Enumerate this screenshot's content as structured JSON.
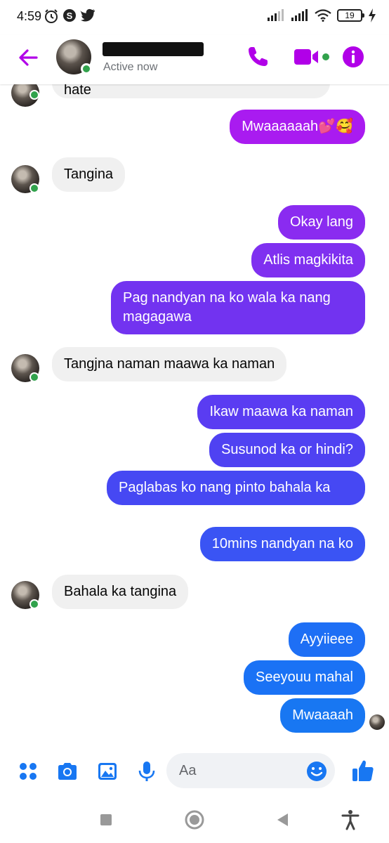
{
  "status_bar": {
    "time": "4:59",
    "battery": "19",
    "icons": [
      "alarm-icon",
      "skype-icon",
      "twitter-icon",
      "signal-icon",
      "signal-icon",
      "wifi-icon",
      "battery-icon",
      "charging-icon"
    ]
  },
  "header": {
    "contact_name": "",
    "status": "Active now",
    "accent_color": "#b100e8",
    "icons": [
      "back-arrow-icon",
      "phone-icon",
      "video-camera-icon",
      "info-icon"
    ]
  },
  "messages": [
    {
      "sender": "them",
      "text": "hate",
      "partial": true
    },
    {
      "sender": "me",
      "text": "Mwaaaaaah💕🥰",
      "color": "#a91bf0"
    },
    {
      "sender": "them",
      "text": "Tangina"
    },
    {
      "sender": "me",
      "text": "Okay lang",
      "color": "#8a2bf0"
    },
    {
      "sender": "me",
      "text": "Atlis magkikita",
      "color": "#7f30f0"
    },
    {
      "sender": "me",
      "text": "Pag nandyan na ko wala ka nang magagawa",
      "color": "#7233f0"
    },
    {
      "sender": "them",
      "text": "Tangjna naman maawa ka naman"
    },
    {
      "sender": "me",
      "text": "Ikaw maawa ka naman",
      "color": "#5a3cf2"
    },
    {
      "sender": "me",
      "text": "Susunod ka or hindi?",
      "color": "#4f42f2"
    },
    {
      "sender": "me",
      "text": "Paglabas ko nang pinto bahala ka",
      "color": "#4648f3"
    },
    {
      "sender": "me",
      "text": "10mins nandyan na ko",
      "color": "#3a54f4"
    },
    {
      "sender": "them",
      "text": "Bahala ka tangina"
    },
    {
      "sender": "me",
      "text": "Ayyiieee",
      "color": "#1e6ff5"
    },
    {
      "sender": "me",
      "text": "Seeyouu mahal",
      "color": "#1a72f5"
    },
    {
      "sender": "me",
      "text": "Mwaaaah",
      "color": "#1877f2"
    }
  ],
  "composer": {
    "placeholder": "Aa",
    "accent_color": "#1877f2",
    "icons": [
      "apps-grid-icon",
      "camera-icon",
      "image-icon",
      "microphone-icon",
      "emoji-icon",
      "thumbs-up-icon"
    ]
  },
  "nav_bar": {
    "icons": [
      "recents-square-icon",
      "home-circle-icon",
      "back-triangle-icon",
      "accessibility-icon"
    ]
  }
}
